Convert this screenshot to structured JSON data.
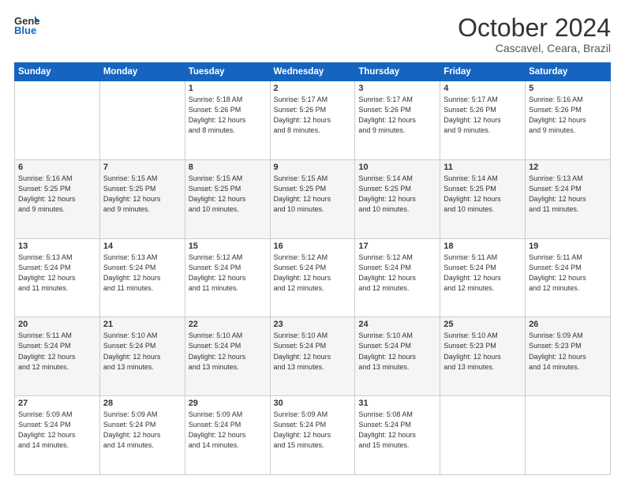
{
  "logo": {
    "line1": "General",
    "line2": "Blue"
  },
  "title": "October 2024",
  "subtitle": "Cascavel, Ceara, Brazil",
  "headers": [
    "Sunday",
    "Monday",
    "Tuesday",
    "Wednesday",
    "Thursday",
    "Friday",
    "Saturday"
  ],
  "weeks": [
    [
      {
        "day": "",
        "info": ""
      },
      {
        "day": "",
        "info": ""
      },
      {
        "day": "1",
        "info": "Sunrise: 5:18 AM\nSunset: 5:26 PM\nDaylight: 12 hours\nand 8 minutes."
      },
      {
        "day": "2",
        "info": "Sunrise: 5:17 AM\nSunset: 5:26 PM\nDaylight: 12 hours\nand 8 minutes."
      },
      {
        "day": "3",
        "info": "Sunrise: 5:17 AM\nSunset: 5:26 PM\nDaylight: 12 hours\nand 9 minutes."
      },
      {
        "day": "4",
        "info": "Sunrise: 5:17 AM\nSunset: 5:26 PM\nDaylight: 12 hours\nand 9 minutes."
      },
      {
        "day": "5",
        "info": "Sunrise: 5:16 AM\nSunset: 5:26 PM\nDaylight: 12 hours\nand 9 minutes."
      }
    ],
    [
      {
        "day": "6",
        "info": "Sunrise: 5:16 AM\nSunset: 5:25 PM\nDaylight: 12 hours\nand 9 minutes."
      },
      {
        "day": "7",
        "info": "Sunrise: 5:15 AM\nSunset: 5:25 PM\nDaylight: 12 hours\nand 9 minutes."
      },
      {
        "day": "8",
        "info": "Sunrise: 5:15 AM\nSunset: 5:25 PM\nDaylight: 12 hours\nand 10 minutes."
      },
      {
        "day": "9",
        "info": "Sunrise: 5:15 AM\nSunset: 5:25 PM\nDaylight: 12 hours\nand 10 minutes."
      },
      {
        "day": "10",
        "info": "Sunrise: 5:14 AM\nSunset: 5:25 PM\nDaylight: 12 hours\nand 10 minutes."
      },
      {
        "day": "11",
        "info": "Sunrise: 5:14 AM\nSunset: 5:25 PM\nDaylight: 12 hours\nand 10 minutes."
      },
      {
        "day": "12",
        "info": "Sunrise: 5:13 AM\nSunset: 5:24 PM\nDaylight: 12 hours\nand 11 minutes."
      }
    ],
    [
      {
        "day": "13",
        "info": "Sunrise: 5:13 AM\nSunset: 5:24 PM\nDaylight: 12 hours\nand 11 minutes."
      },
      {
        "day": "14",
        "info": "Sunrise: 5:13 AM\nSunset: 5:24 PM\nDaylight: 12 hours\nand 11 minutes."
      },
      {
        "day": "15",
        "info": "Sunrise: 5:12 AM\nSunset: 5:24 PM\nDaylight: 12 hours\nand 11 minutes."
      },
      {
        "day": "16",
        "info": "Sunrise: 5:12 AM\nSunset: 5:24 PM\nDaylight: 12 hours\nand 12 minutes."
      },
      {
        "day": "17",
        "info": "Sunrise: 5:12 AM\nSunset: 5:24 PM\nDaylight: 12 hours\nand 12 minutes."
      },
      {
        "day": "18",
        "info": "Sunrise: 5:11 AM\nSunset: 5:24 PM\nDaylight: 12 hours\nand 12 minutes."
      },
      {
        "day": "19",
        "info": "Sunrise: 5:11 AM\nSunset: 5:24 PM\nDaylight: 12 hours\nand 12 minutes."
      }
    ],
    [
      {
        "day": "20",
        "info": "Sunrise: 5:11 AM\nSunset: 5:24 PM\nDaylight: 12 hours\nand 12 minutes."
      },
      {
        "day": "21",
        "info": "Sunrise: 5:10 AM\nSunset: 5:24 PM\nDaylight: 12 hours\nand 13 minutes."
      },
      {
        "day": "22",
        "info": "Sunrise: 5:10 AM\nSunset: 5:24 PM\nDaylight: 12 hours\nand 13 minutes."
      },
      {
        "day": "23",
        "info": "Sunrise: 5:10 AM\nSunset: 5:24 PM\nDaylight: 12 hours\nand 13 minutes."
      },
      {
        "day": "24",
        "info": "Sunrise: 5:10 AM\nSunset: 5:24 PM\nDaylight: 12 hours\nand 13 minutes."
      },
      {
        "day": "25",
        "info": "Sunrise: 5:10 AM\nSunset: 5:23 PM\nDaylight: 12 hours\nand 13 minutes."
      },
      {
        "day": "26",
        "info": "Sunrise: 5:09 AM\nSunset: 5:23 PM\nDaylight: 12 hours\nand 14 minutes."
      }
    ],
    [
      {
        "day": "27",
        "info": "Sunrise: 5:09 AM\nSunset: 5:24 PM\nDaylight: 12 hours\nand 14 minutes."
      },
      {
        "day": "28",
        "info": "Sunrise: 5:09 AM\nSunset: 5:24 PM\nDaylight: 12 hours\nand 14 minutes."
      },
      {
        "day": "29",
        "info": "Sunrise: 5:09 AM\nSunset: 5:24 PM\nDaylight: 12 hours\nand 14 minutes."
      },
      {
        "day": "30",
        "info": "Sunrise: 5:09 AM\nSunset: 5:24 PM\nDaylight: 12 hours\nand 15 minutes."
      },
      {
        "day": "31",
        "info": "Sunrise: 5:08 AM\nSunset: 5:24 PM\nDaylight: 12 hours\nand 15 minutes."
      },
      {
        "day": "",
        "info": ""
      },
      {
        "day": "",
        "info": ""
      }
    ]
  ]
}
